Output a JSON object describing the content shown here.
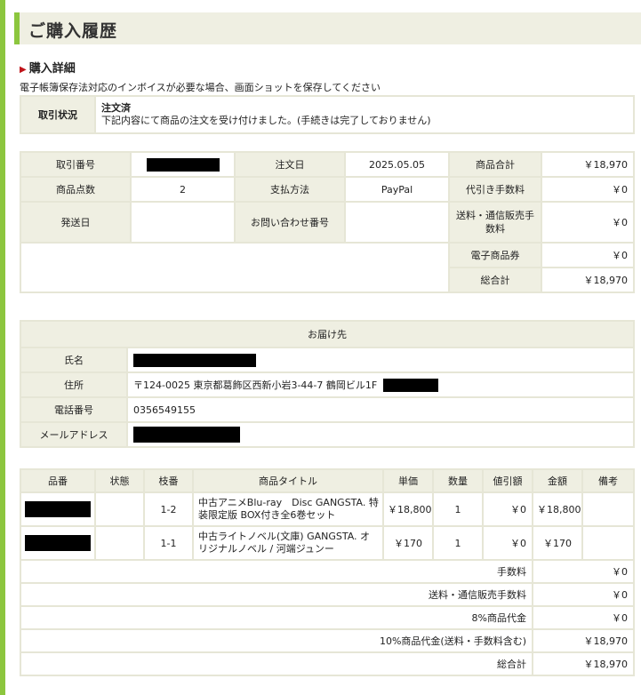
{
  "page": {
    "title": "ご購入履歴",
    "section_heading": "購入詳細",
    "notice": "電子帳簿保存法対応のインボイスが必要な場合、画面ショットを保存してください"
  },
  "status": {
    "label": "取引状況",
    "value_title": "注文済",
    "value_detail": "下記内容にて商品の注文を受け付けました。(手続きは完了しておりません)"
  },
  "order": {
    "transaction_no_label": "取引番号",
    "order_date_label": "注文日",
    "order_date": "2025.05.05",
    "product_total_label": "商品合計",
    "product_total": "￥18,970",
    "item_count_label": "商品点数",
    "item_count": "2",
    "payment_label": "支払方法",
    "payment": "PayPal",
    "cod_fee_label": "代引き手数料",
    "cod_fee": "￥0",
    "ship_date_label": "発送日",
    "inquiry_label": "お問い合わせ番号",
    "shipping_fee_label": "送料・通信販売手数料",
    "shipping_fee": "￥0",
    "e_voucher_label": "電子商品券",
    "e_voucher": "￥0",
    "grand_total_label": "総合計",
    "grand_total": "￥18,970"
  },
  "delivery": {
    "heading": "お届け先",
    "name_label": "氏名",
    "address_label": "住所",
    "address": "〒124-0025 東京都葛飾区西新小岩3-44-7 鶴岡ビル1F",
    "phone_label": "電話番号",
    "phone": "0356549155",
    "email_label": "メールアドレス"
  },
  "items": {
    "headers": [
      "品番",
      "状態",
      "枝番",
      "商品タイトル",
      "単価",
      "数量",
      "値引額",
      "金額",
      "備考"
    ],
    "rows": [
      {
        "branch": "1-2",
        "title": "中古アニメBlu-ray　Disc GANGSTA. 特装限定版 BOX付き全6巻セット",
        "unit_price": "￥18,800",
        "qty": "1",
        "discount": "￥0",
        "amount": "￥18,800",
        "note": ""
      },
      {
        "branch": "1-1",
        "title": "中古ライトノベル(文庫) GANGSTA. オリジナルノベル / 河端ジュンー",
        "unit_price": "￥170",
        "qty": "1",
        "discount": "￥0",
        "amount": "￥170",
        "note": ""
      }
    ],
    "summary": [
      {
        "label": "手数料",
        "value": "￥0"
      },
      {
        "label": "送料・通信販売手数料",
        "value": "￥0"
      },
      {
        "label": "8%商品代金",
        "value": "￥0"
      },
      {
        "label": "10%商品代金(送料・手数料含む)",
        "value": "￥18,970"
      },
      {
        "label": "総合計",
        "value": "￥18,970"
      }
    ]
  },
  "colors": {
    "accent": "#8cc63e",
    "label_bg": "#efefe2",
    "border": "#e6e6d6",
    "arrow": "#c0141a"
  }
}
